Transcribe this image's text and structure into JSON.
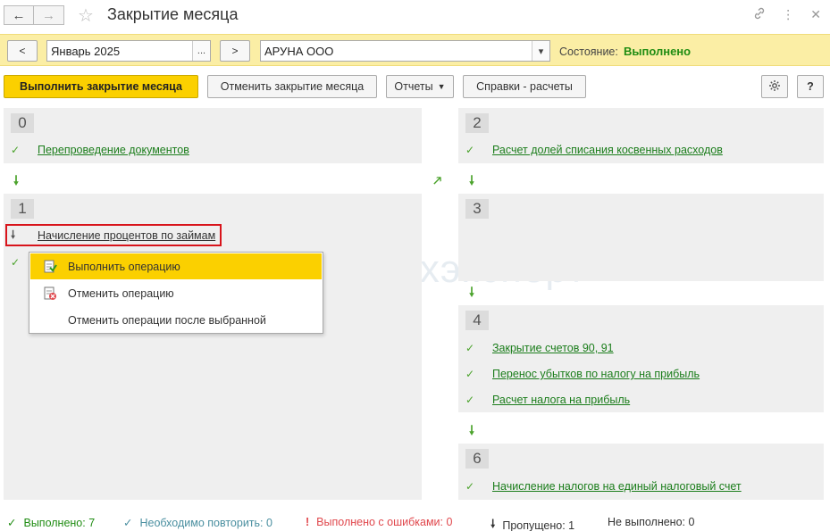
{
  "window": {
    "title": "Закрытие месяца"
  },
  "filter": {
    "prev_label": "<",
    "period_value": "Январь 2025",
    "period_choose": "...",
    "next_label": ">",
    "org_value": "АРУНА ООО",
    "state_label": "Состояние:",
    "state_value": "Выполнено"
  },
  "toolbar": {
    "run_label": "Выполнить закрытие месяца",
    "cancel_label": "Отменить закрытие месяца",
    "reports_label": "Отчеты",
    "refs_label": "Справки - расчеты",
    "help_label": "?"
  },
  "sections": {
    "s0": {
      "num": "0",
      "ops": [
        "Перепроведение документов"
      ]
    },
    "s1": {
      "num": "1",
      "ops": [
        "Начисление процентов по займам"
      ]
    },
    "s2": {
      "num": "2",
      "ops": [
        "Расчет долей списания косвенных расходов"
      ]
    },
    "s3": {
      "num": "3",
      "ops": []
    },
    "s4": {
      "num": "4",
      "ops": [
        "Закрытие счетов 90, 91",
        "Перенос убытков по налогу на прибыль",
        "Расчет налога на прибыль"
      ]
    },
    "s6": {
      "num": "6",
      "ops": [
        "Начисление налогов на единый налоговый счет"
      ]
    }
  },
  "menu": {
    "items": [
      "Выполнить операцию",
      "Отменить операцию",
      "Отменить операции после выбранной"
    ]
  },
  "watermark": {
    "text": "Бухэксперт"
  },
  "status": {
    "done": "Выполнено: 7",
    "repeat": "Необходимо повторить: 0",
    "errors": "Выполнено с ошибками: 0",
    "skipped": "Пропущено: 1",
    "not_done": "Не выполнено: 0"
  },
  "colors": {
    "accent_yellow": "#fbd000",
    "filter_bg": "#fbeea5",
    "ok_green": "#1f8c12",
    "link_green": "#1b7d1b",
    "highlight_red": "#d8141b",
    "repeat_teal": "#4a8fa0",
    "error_red": "#e0474c"
  }
}
